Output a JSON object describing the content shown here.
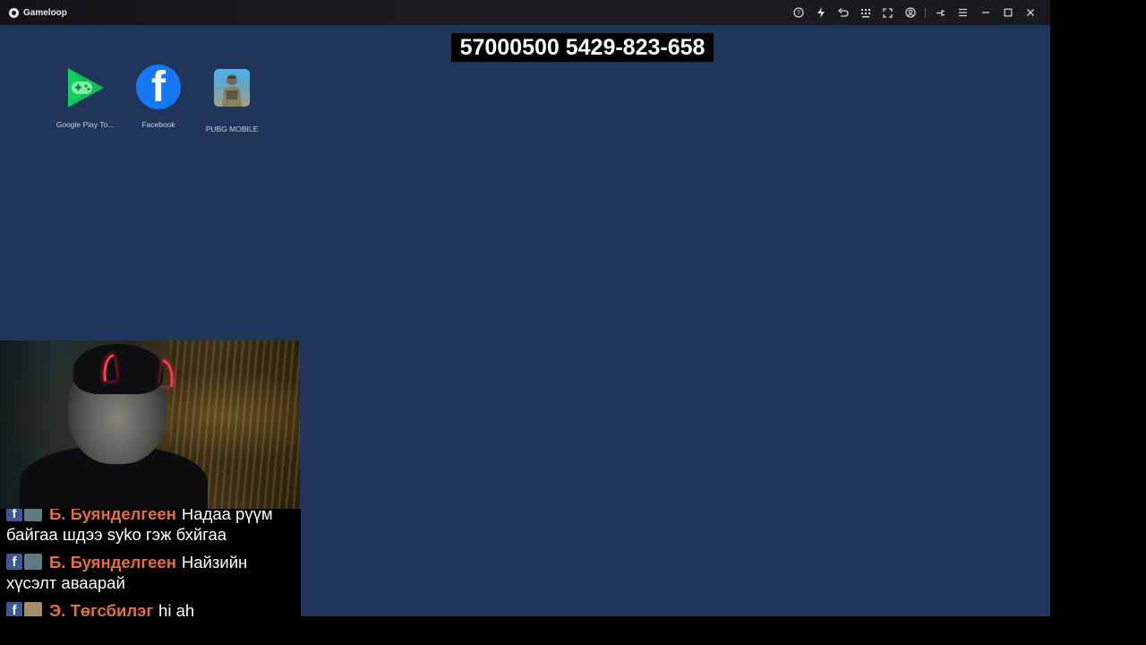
{
  "window": {
    "title": "Gameloop",
    "titlebar_icons": [
      "help-icon",
      "boost-icon",
      "undo-icon",
      "keymap-icon",
      "fullscreen-icon",
      "account-icon",
      "pin-icon",
      "menu-icon",
      "minimize-icon",
      "maximize-icon",
      "close-icon"
    ]
  },
  "overlay": {
    "phone_text": "57000500 5429-823-658"
  },
  "desktop": {
    "apps": [
      {
        "label": "Google Play To...",
        "icon": "google-play-games-icon"
      },
      {
        "label": "Facebook",
        "icon": "facebook-icon"
      },
      {
        "label": "PUBG MOBILE",
        "icon": "pubg-mobile-icon"
      }
    ]
  },
  "chat": {
    "messages": [
      {
        "author": "Б. Буянделгеен",
        "text": "Надаа рүүм байгаа шдээ syko гэж бхйгаа",
        "avatar_color": "#5f7a83"
      },
      {
        "author": "Б. Буянделгеен",
        "text": "Найзийн хүсэлт аваарай",
        "avatar_color": "#5f7a83"
      },
      {
        "author": "Э. Төгсбилэг",
        "text": "hi ah",
        "avatar_color": "#a58c6a"
      }
    ]
  },
  "colors": {
    "desktop_bg": "#1f355a",
    "chat_author": "#e2703c",
    "horn": "#ff3b4e"
  }
}
